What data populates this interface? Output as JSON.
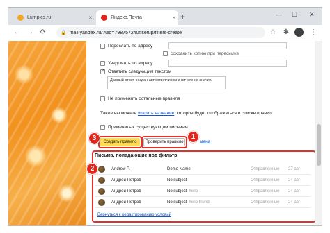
{
  "browser": {
    "tabs": [
      {
        "title": "Lumpics.ru",
        "favicon_color": "#f5a623",
        "active": false
      },
      {
        "title": "Яндекс.Почта",
        "favicon_color": "#e2271f",
        "active": true
      }
    ],
    "close_glyph": "×",
    "new_tab_glyph": "+",
    "window_controls": {
      "minimize": "—",
      "maximize": "☐",
      "close": "✕"
    },
    "nav": {
      "back": "←",
      "forward": "→",
      "reload": "⟳",
      "lock": "🔒"
    },
    "url": "mail.yandex.ru/?uid=798757240#setup/filters-create",
    "toolbar_icons": {
      "star": "☆",
      "extensions": "✱",
      "menu": "⋮"
    }
  },
  "form": {
    "forward_label": "Переслать по адресу",
    "keep_copy_label": "сохранить копию при пересылке",
    "notify_label": "Уведомить по адресу",
    "autoreply_label": "Ответить следующим текстом",
    "autoreply_text": "Данный ответ создан автоответчиком и ничего не значит.",
    "stop_rules_label": "Не применять остальные правила",
    "name_prefix": "Также вы можете",
    "name_link": "указать название",
    "name_suffix": ", которое будет отображаться в списке правил",
    "apply_existing_label": "Применить к существующим письмам",
    "create_button": "Создать правило",
    "check_button": "Проверить правило",
    "hidden_link_tail": "мена"
  },
  "badges": {
    "one": "1",
    "two": "2",
    "three": "3"
  },
  "results": {
    "title": "Письма, попадающие под фильтр",
    "rows": [
      {
        "from": "Andrew P.",
        "subject": "Demo Name",
        "snippet": "",
        "folder": "Отправленные",
        "date": "27 авг"
      },
      {
        "from": "Андрей Петров",
        "subject": "No subject",
        "snippet": "",
        "folder": "Отправленные",
        "date": "24 авг"
      },
      {
        "from": "Андрей Петров",
        "subject": "No subject",
        "snippet": "hello",
        "folder": "Отправленные",
        "date": "24 авг"
      },
      {
        "from": "Андрей Петров",
        "subject": "No subject",
        "snippet": "hello friend",
        "folder": "Отправленные",
        "date": "24 авг"
      }
    ],
    "back_link": "Вернуться к редактированию условий"
  },
  "colors": {
    "accent_red": "#e0302a",
    "button_yellow": "#ffdb4d",
    "link_blue": "#1155cc"
  }
}
